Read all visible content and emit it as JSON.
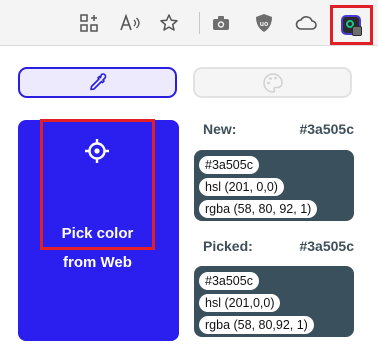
{
  "toolbar": {
    "icons": [
      "app-grid-add-icon",
      "read-aloud-icon",
      "favorite-star-icon",
      "camera-icon",
      "ublock-shield-icon",
      "cloud-icon",
      "color-picker-extension-icon"
    ]
  },
  "tabs": {
    "picker_icon": "eyedropper-icon",
    "palette_icon": "palette-icon"
  },
  "pick_button": {
    "line1": "Pick color",
    "line2": "from Web",
    "icon": "crosshair-icon"
  },
  "new_color": {
    "title": "New:",
    "hex": "#3a505c",
    "chips": [
      "#3a505c",
      "hsl (201, 0,0)",
      "rgba (58, 80, 92, 1)"
    ],
    "swatch_color": "#3a505c"
  },
  "picked_color": {
    "title": "Picked:",
    "hex": "#3a505c",
    "chips": [
      "#3a505c",
      "hsl (201,0,0)",
      "rgba (58, 80,92, 1)"
    ],
    "swatch_color": "#3a505c"
  },
  "colors": {
    "accent": "#2b1ff0",
    "highlight": "#e01f26"
  }
}
